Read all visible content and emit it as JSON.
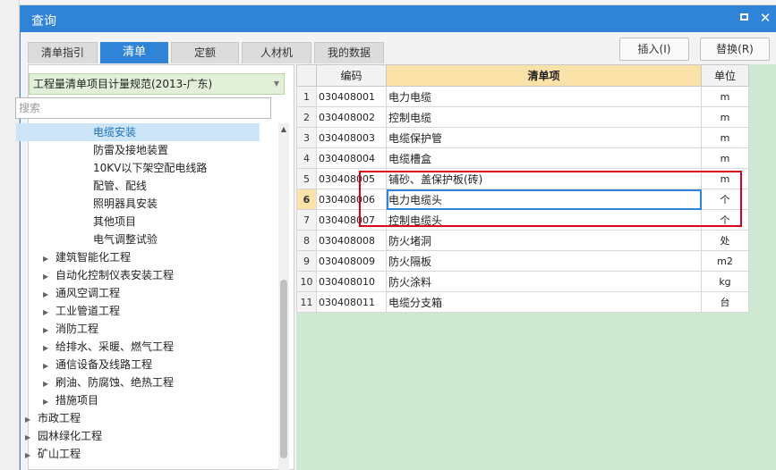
{
  "dialog": {
    "title": "查询"
  },
  "tabs": [
    {
      "label": "清单指引",
      "active": false
    },
    {
      "label": "清单",
      "active": true
    },
    {
      "label": "定额",
      "active": false
    },
    {
      "label": "人材机",
      "active": false
    },
    {
      "label": "我的数据",
      "active": false
    }
  ],
  "buttons": {
    "insert": "插入(I)",
    "replace": "替换(R)"
  },
  "spec_select": {
    "value": "工程量清单项目计量规范(2013-广东)"
  },
  "search": {
    "placeholder": "搜索"
  },
  "tree": [
    {
      "label": "电缆安装",
      "level": 2,
      "selected": true,
      "expandable": false
    },
    {
      "label": "防雷及接地装置",
      "level": 2,
      "selected": false,
      "expandable": false
    },
    {
      "label": "10KV以下架空配电线路",
      "level": 2,
      "selected": false,
      "expandable": false
    },
    {
      "label": "配管、配线",
      "level": 2,
      "selected": false,
      "expandable": false
    },
    {
      "label": "照明器具安装",
      "level": 2,
      "selected": false,
      "expandable": false
    },
    {
      "label": "其他项目",
      "level": 2,
      "selected": false,
      "expandable": false
    },
    {
      "label": "电气调整试验",
      "level": 2,
      "selected": false,
      "expandable": false
    },
    {
      "label": "建筑智能化工程",
      "level": 1,
      "selected": false,
      "expandable": true
    },
    {
      "label": "自动化控制仪表安装工程",
      "level": 1,
      "selected": false,
      "expandable": true
    },
    {
      "label": "通风空调工程",
      "level": 1,
      "selected": false,
      "expandable": true
    },
    {
      "label": "工业管道工程",
      "level": 1,
      "selected": false,
      "expandable": true
    },
    {
      "label": "消防工程",
      "level": 1,
      "selected": false,
      "expandable": true
    },
    {
      "label": "给排水、采暖、燃气工程",
      "level": 1,
      "selected": false,
      "expandable": true
    },
    {
      "label": "通信设备及线路工程",
      "level": 1,
      "selected": false,
      "expandable": true
    },
    {
      "label": "刷油、防腐蚀、绝热工程",
      "level": 1,
      "selected": false,
      "expandable": true
    },
    {
      "label": "措施项目",
      "level": 1,
      "selected": false,
      "expandable": true
    },
    {
      "label": "市政工程",
      "level": 0,
      "selected": false,
      "expandable": true
    },
    {
      "label": "园林绿化工程",
      "level": 0,
      "selected": false,
      "expandable": true
    },
    {
      "label": "矿山工程",
      "level": 0,
      "selected": false,
      "expandable": true
    }
  ],
  "grid": {
    "columns": [
      "编码",
      "清单项",
      "单位"
    ],
    "current_row": 6,
    "rows": [
      {
        "idx": "1",
        "code": "030408001",
        "name": "电力电缆",
        "unit": "m"
      },
      {
        "idx": "2",
        "code": "030408002",
        "name": "控制电缆",
        "unit": "m"
      },
      {
        "idx": "3",
        "code": "030408003",
        "name": "电缆保护管",
        "unit": "m"
      },
      {
        "idx": "4",
        "code": "030408004",
        "name": "电缆槽盒",
        "unit": "m"
      },
      {
        "idx": "5",
        "code": "030408005",
        "name": "铺砂、盖保护板(砖)",
        "unit": "m"
      },
      {
        "idx": "6",
        "code": "030408006",
        "name": "电力电缆头",
        "unit": "个"
      },
      {
        "idx": "7",
        "code": "030408007",
        "name": "控制电缆头",
        "unit": "个"
      },
      {
        "idx": "8",
        "code": "030408008",
        "name": "防火堵洞",
        "unit": "处"
      },
      {
        "idx": "9",
        "code": "030408009",
        "name": "防火隔板",
        "unit": "m2"
      },
      {
        "idx": "10",
        "code": "030408010",
        "name": "防火涂料",
        "unit": "kg"
      },
      {
        "idx": "11",
        "code": "030408011",
        "name": "电缆分支箱",
        "unit": "台"
      }
    ]
  },
  "colors": {
    "accent": "#2f84d8",
    "highlight_box": "#d9001b",
    "grid_bg": "#cfe8d1",
    "selected_header": "#fbe2a9"
  }
}
